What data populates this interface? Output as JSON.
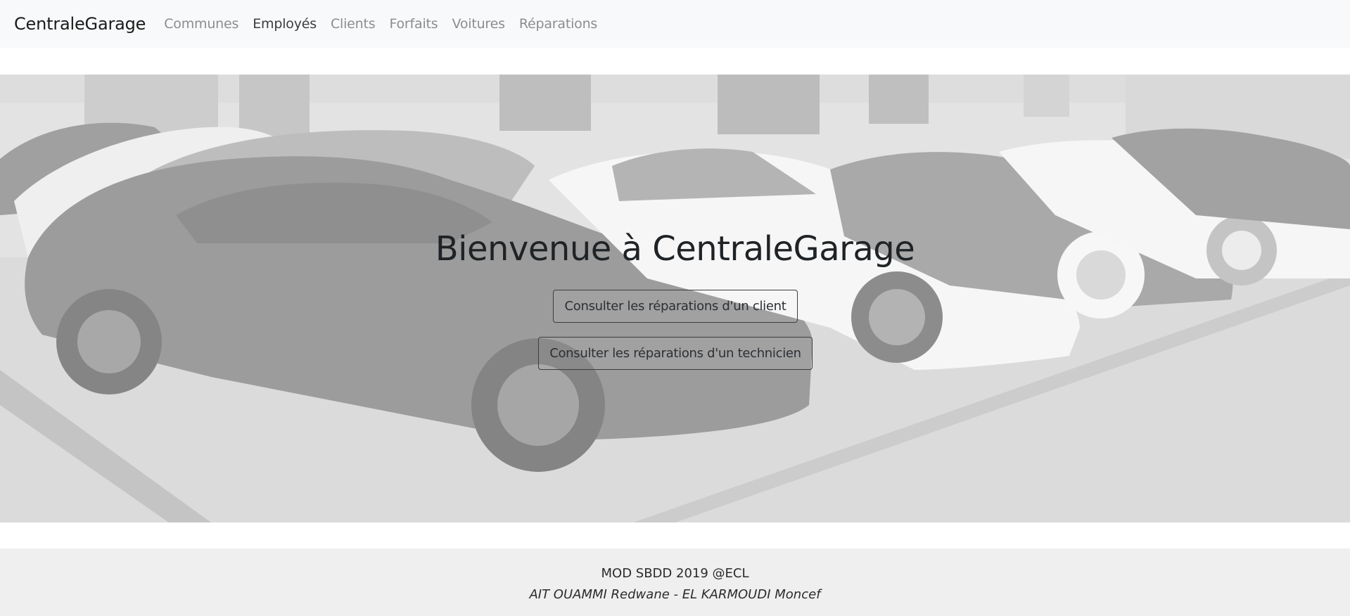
{
  "navbar": {
    "brand": "CentraleGarage",
    "items": [
      {
        "label": "Communes",
        "active": false
      },
      {
        "label": "Employés",
        "active": true
      },
      {
        "label": "Clients",
        "active": false
      },
      {
        "label": "Forfaits",
        "active": false
      },
      {
        "label": "Voitures",
        "active": false
      },
      {
        "label": "Réparations",
        "active": false
      }
    ]
  },
  "hero": {
    "title": "Bienvenue à CentraleGarage",
    "buttons": {
      "client": "Consulter les réparations d'un client",
      "technician": "Consulter les réparations d'un technicien"
    }
  },
  "footer": {
    "line1": "MOD SBDD 2019 @ECL",
    "line2": "AIT OUAMMI Redwane - EL KARMOUDI Moncef"
  },
  "colors": {
    "navbar_bg": "#f8f9fa",
    "footer_bg": "#efefef",
    "nav_inactive": "#8a8d91",
    "nav_active": "#3a3d40"
  }
}
